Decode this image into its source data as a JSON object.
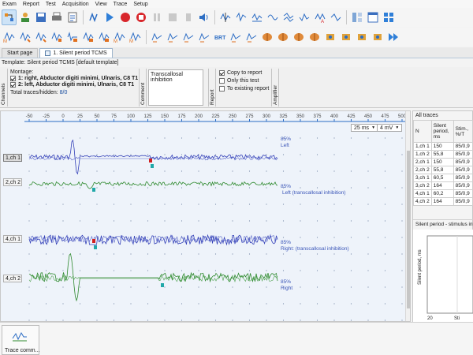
{
  "menu": [
    "Exam",
    "Report",
    "Test",
    "Acquisition",
    "View",
    "Trace",
    "Setup"
  ],
  "toolbar1": [
    {
      "name": "traces-icon"
    },
    {
      "name": "clinic-icon"
    },
    {
      "name": "save-icon"
    },
    {
      "name": "print-icon"
    },
    {
      "name": "settings-icon"
    },
    {
      "name": "play-icon"
    },
    {
      "name": "record-icon"
    },
    {
      "name": "stop-icon"
    },
    {
      "name": "pause-icon"
    },
    {
      "name": "volume-icon"
    },
    {
      "name": "cursor-icon"
    },
    {
      "name": "window-icon"
    }
  ],
  "tabs": {
    "start": "Start page",
    "active": "1. Silent period TCMS"
  },
  "template_line": "Template: Silent period TCMS [default template]",
  "side_tabs": {
    "channels": "Channels",
    "comment": "Comment",
    "report": "Report",
    "amplifier": "Amplifier"
  },
  "montage": {
    "label": "Montage:",
    "ch1": "1: right, Abductor digiti minimi, Ulnaris, C8 T1",
    "ch2": "2: left, Abductor digiti minimi, Ulnaris, C8 T1",
    "total_label": "Total traces/hidden:",
    "total_value": "8/0"
  },
  "comment_text": "Transcallosal inhibition",
  "report_opts": {
    "copy": "Copy to report",
    "only": "Only this test",
    "existing": "To existing report"
  },
  "timebase": {
    "sweep": "25 ms",
    "gain": "4 mV"
  },
  "ruler_ticks": [
    "-50",
    "-25",
    "0",
    "25",
    "50",
    "75",
    "100",
    "125",
    "150",
    "175",
    "200",
    "225",
    "250",
    "275",
    "300",
    "325",
    "350",
    "375",
    "400",
    "425",
    "450",
    "475",
    "500",
    "525"
  ],
  "channels": {
    "ch1a": "1,ch 1",
    "ch2a": "2,ch 2",
    "ch1b": "4,ch 1",
    "ch2b": "4,ch 2"
  },
  "trace_notes": {
    "a1": "85%",
    "a1b": "Left",
    "a2": "85%",
    "a2b": "Left (transcallosal inhibition)",
    "b1": "85%",
    "b1b": "Right: (transcallosal inhibition)",
    "b2": "85%",
    "b2b": "Right"
  },
  "all_traces": {
    "title": "All traces",
    "headers": [
      "N",
      "Silent period, ms",
      "Stim., %/T"
    ],
    "rows": [
      [
        "1,ch 1",
        "150",
        "85/0,9"
      ],
      [
        "1,ch 2",
        "55,8",
        "85/0,9"
      ],
      [
        "2,ch 1",
        "150",
        "85/0,9"
      ],
      [
        "2,ch 2",
        "55,8",
        "85/0,9"
      ],
      [
        "3,ch 1",
        "60,5",
        "85/0,9"
      ],
      [
        "3,ch 2",
        "164",
        "85/0,9"
      ],
      [
        "4,ch 1",
        "60,2",
        "85/0,9"
      ],
      [
        "4,ch 2",
        "164",
        "85/0,9"
      ]
    ]
  },
  "graph": {
    "title": "Silent period - stimulus intensity",
    "ylabel": "Silent period, ms",
    "xtick0": "20",
    "xtick1": "Sti"
  },
  "bottom": {
    "trace_comm": "Trace comm..."
  },
  "colors": {
    "trace_blue": "#3340b8",
    "trace_green": "#2f8a2f",
    "marker_cyan": "#20a8a8",
    "marker_red": "#d02020"
  }
}
